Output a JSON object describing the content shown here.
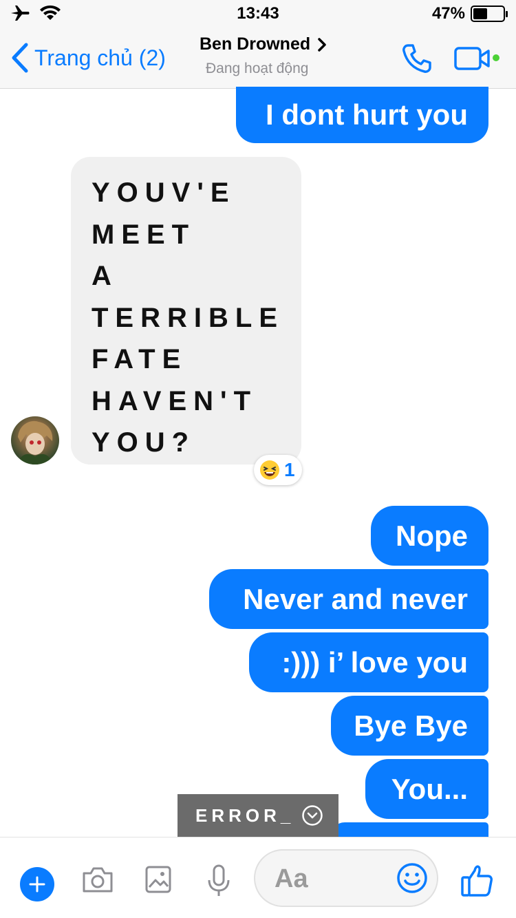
{
  "status_bar": {
    "time": "13:43",
    "battery_text": "47%",
    "battery_level": 0.47,
    "icons": [
      "airplane-icon",
      "wifi-icon",
      "battery-icon"
    ]
  },
  "nav": {
    "back_label": "Trang chủ (2)",
    "contact_name": "Ben Drowned",
    "contact_status": "Đang hoạt động",
    "icons": [
      "chevron-left-icon",
      "chevron-right-icon",
      "phone-icon",
      "video-camera-icon"
    ]
  },
  "messages": {
    "out_1": "I dont hurt you",
    "incoming_lines": [
      "YOUV'E",
      "MEET",
      "A",
      "TERRIBLE",
      "FATE",
      "HAVEN'T",
      "YOU?"
    ],
    "reaction_emoji": "laughing-emoji",
    "reaction_count": "1",
    "out_2": "Nope",
    "out_3": "Never and never",
    "out_4": ":))) i’ love you",
    "out_5": "Bye Bye",
    "out_6": "You..."
  },
  "toast": {
    "text": "ERROR_"
  },
  "composer": {
    "placeholder": "Aa",
    "icons": [
      "plus-icon",
      "camera-icon",
      "image-icon",
      "microphone-icon",
      "emoji-icon",
      "thumbs-up-icon"
    ]
  },
  "colors": {
    "accent": "#0a7cff",
    "incoming_bubble": "#f0f0f0",
    "active": "#4cd137"
  }
}
